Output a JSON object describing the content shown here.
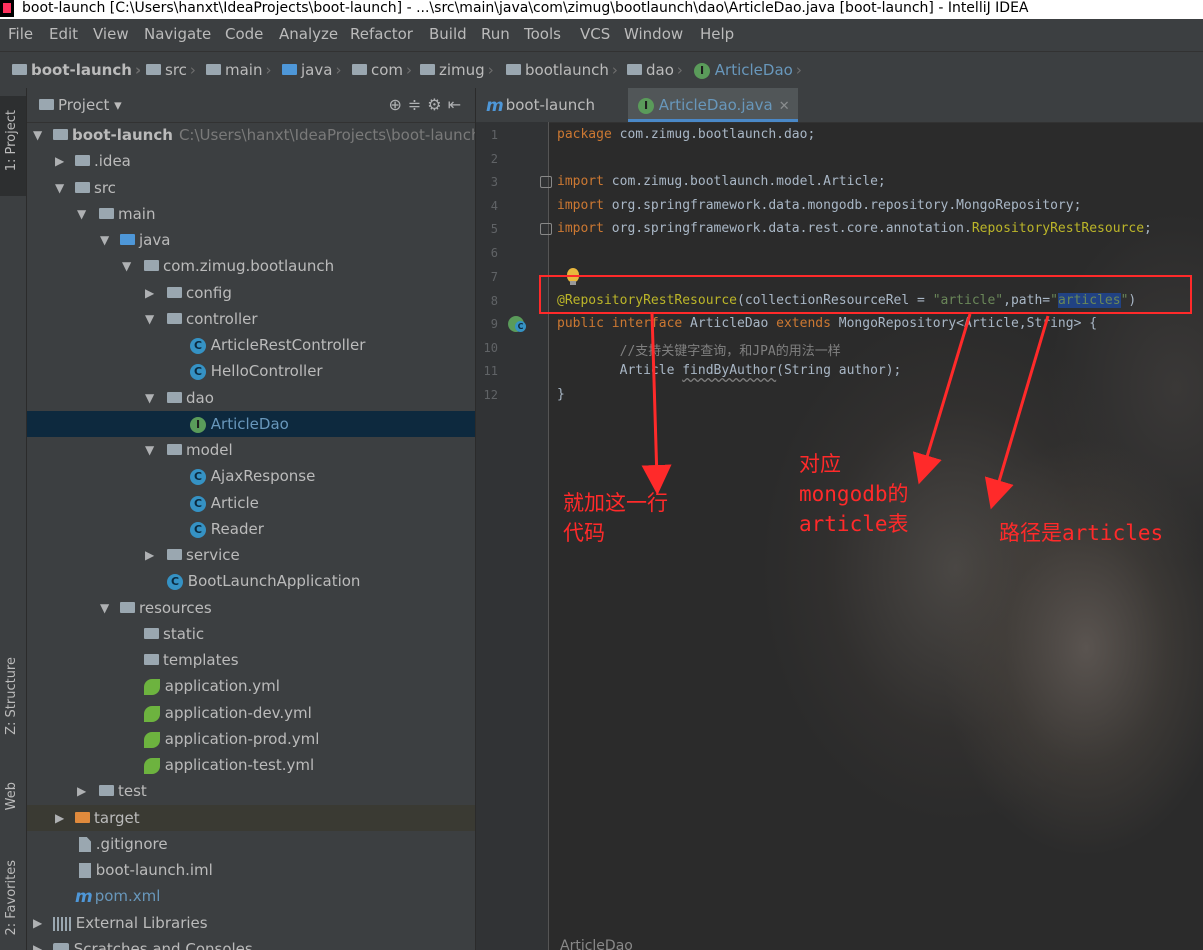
{
  "window": {
    "title": "boot-launch [C:\\Users\\hanxt\\IdeaProjects\\boot-launch] - ...\\src\\main\\java\\com\\zimug\\bootlaunch\\dao\\ArticleDao.java [boot-launch] - IntelliJ IDEA"
  },
  "menu": [
    "File",
    "Edit",
    "View",
    "Navigate",
    "Code",
    "Analyze",
    "Refactor",
    "Build",
    "Run",
    "Tools",
    "VCS",
    "Window",
    "Help"
  ],
  "breadcrumb": [
    "boot-launch",
    "src",
    "main",
    "java",
    "com",
    "zimug",
    "bootlaunch",
    "dao",
    "ArticleDao"
  ],
  "left_tools": [
    "1: Project",
    "Z: Structure",
    "Web",
    "2: Favorites"
  ],
  "project_panel": {
    "title": "Project",
    "root_label": "boot-launch",
    "root_path": "C:\\Users\\hanxt\\IdeaProjects\\boot-launch",
    "items": [
      ".idea",
      "src",
      "main",
      "java",
      "com.zimug.bootlaunch",
      "config",
      "controller",
      "ArticleRestController",
      "HelloController",
      "dao",
      "ArticleDao",
      "model",
      "AjaxResponse",
      "Article",
      "Reader",
      "service",
      "BootLaunchApplication",
      "resources",
      "static",
      "templates",
      "application.yml",
      "application-dev.yml",
      "application-prod.yml",
      "application-test.yml",
      "test",
      "target",
      ".gitignore",
      "boot-launch.iml",
      "pom.xml",
      "External Libraries",
      "Scratches and Consoles"
    ]
  },
  "tabs": [
    {
      "label": "boot-launch"
    },
    {
      "label": "ArticleDao.java"
    }
  ],
  "code_lines": [
    "package com.zimug.bootlaunch.dao;",
    "",
    "import com.zimug.bootlaunch.model.Article;",
    "import org.springframework.data.mongodb.repository.MongoRepository;",
    "import org.springframework.data.rest.core.annotation.RepositoryRestResource;",
    "",
    "",
    "@RepositoryRestResource(collectionResourceRel = \"article\",path=\"articles\")",
    "public interface ArticleDao extends MongoRepository<Article,String> {",
    "        //支持关键字查询，和JPA的用法一样",
    "        Article findByAuthor(String author);",
    "}"
  ],
  "line_numbers": [
    "1",
    "2",
    "3",
    "4",
    "5",
    "6",
    "7",
    "8",
    "9",
    "10",
    "11",
    "12"
  ],
  "annotations": {
    "note1": "就加这一行\n代码",
    "note2": "对应\nmongodb的\narticle表",
    "note3": "路径是articles",
    "color": "#ff2a2a"
  },
  "bottom_tab": "ArticleDao",
  "colors": {
    "keyword": "#cc7832",
    "annotation": "#bbb529",
    "string": "#6a8759",
    "selection": "#0d293e"
  }
}
